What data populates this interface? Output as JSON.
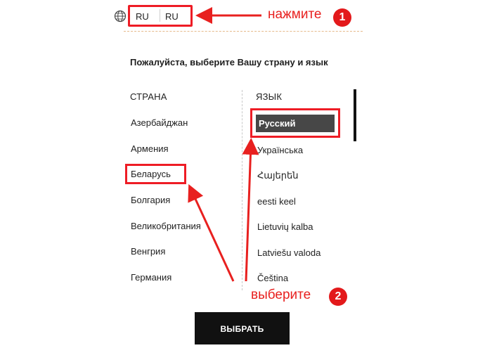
{
  "header": {
    "lang_codes": [
      "RU",
      "RU"
    ],
    "icon": "globe-icon"
  },
  "panel": {
    "title": "Пожалуйста, выберите Вашу страну и язык",
    "country_header": "СТРАНА",
    "language_header": "ЯЗЫК",
    "countries": [
      "Азербайджан",
      "Армения",
      "Беларусь",
      "Болгария",
      "Великобритания",
      "Венгрия",
      "Германия"
    ],
    "selected_country": "Беларусь",
    "languages": [
      "Русский",
      "Українська",
      "Հայերեն",
      "eesti keel",
      "Lietuvių kalba",
      "Latviešu valoda",
      "Čeština"
    ],
    "selected_language": "Русский",
    "confirm_label": "ВЫБРАТЬ"
  },
  "annotations": {
    "step1_text": "нажмите",
    "step1_number": "1",
    "step2_text": "выберите",
    "step2_number": "2",
    "color": "#e8201f"
  },
  "colors": {
    "highlight": "#ee1c25",
    "selected_bg": "#474747",
    "button_bg": "#111111"
  }
}
